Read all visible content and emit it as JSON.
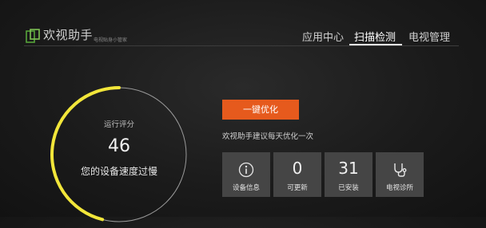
{
  "header": {
    "app_title": "欢视助手",
    "app_subtitle": "电视贴身小管家",
    "nav": [
      "应用中心",
      "扫描检测",
      "电视管理"
    ],
    "active_nav": "扫描检测"
  },
  "score": {
    "label": "运行评分",
    "value": "46",
    "message": "您的设备速度过慢",
    "progress": 0.46,
    "arc_color": "#f2e63a"
  },
  "actions": {
    "optimize_label": "一键优化",
    "suggestion": "欢视助手建议每天优化一次",
    "accent": "#e65a1d"
  },
  "tiles": [
    {
      "label": "设备信息",
      "icon": "info-icon"
    },
    {
      "label": "可更新",
      "value": "0"
    },
    {
      "label": "已安装",
      "value": "31"
    },
    {
      "label": "电视诊所",
      "icon": "stethoscope-icon"
    }
  ]
}
